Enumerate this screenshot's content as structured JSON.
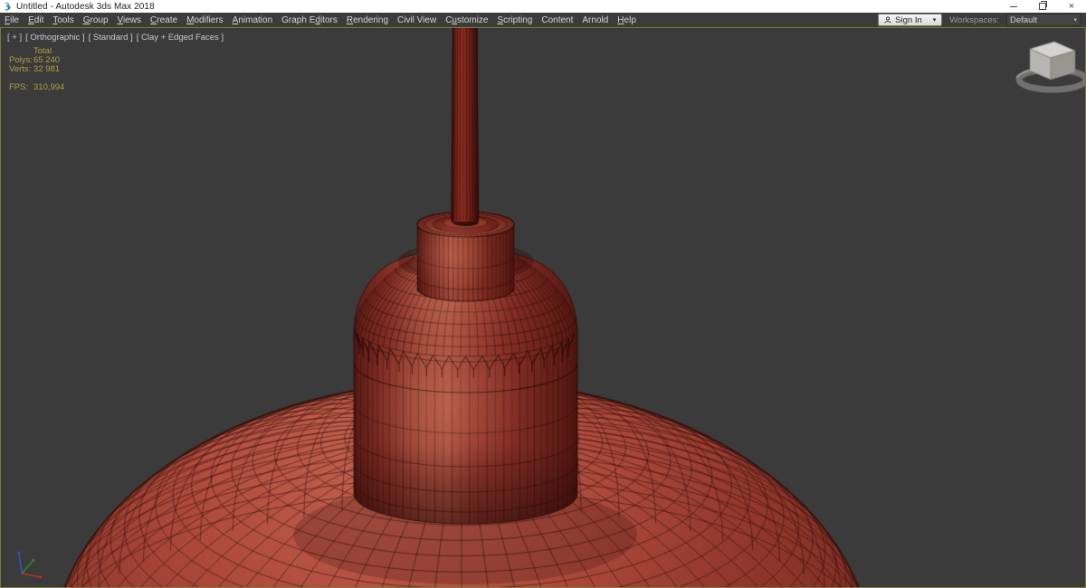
{
  "window": {
    "title": "Untitled - Autodesk 3ds Max 2018",
    "app_icon": "3ds-max-logo-icon",
    "controls": {
      "minimize_icon": "minimize-icon",
      "restore_icon": "restore-window-icon",
      "close_icon": "close-icon",
      "close_glyph": "×"
    }
  },
  "menu_bar": {
    "items": [
      {
        "label": "File",
        "u": 0
      },
      {
        "label": "Edit",
        "u": 0
      },
      {
        "label": "Tools",
        "u": 0
      },
      {
        "label": "Group",
        "u": 0
      },
      {
        "label": "Views",
        "u": 0
      },
      {
        "label": "Create",
        "u": 0
      },
      {
        "label": "Modifiers",
        "u": 0
      },
      {
        "label": "Animation",
        "u": 0
      },
      {
        "label": "Graph Editors",
        "u": 7
      },
      {
        "label": "Rendering",
        "u": 0
      },
      {
        "label": "Civil View",
        "u": -1
      },
      {
        "label": "Customize",
        "u": 1
      },
      {
        "label": "Scripting",
        "u": 0
      },
      {
        "label": "Content",
        "u": -1
      },
      {
        "label": "Arnold",
        "u": -1
      },
      {
        "label": "Help",
        "u": 0
      }
    ],
    "sign_in": {
      "label": "Sign In",
      "icon": "user-icon",
      "caret": "▾"
    },
    "workspaces": {
      "label": "Workspaces:",
      "value": "Default",
      "caret": "▾"
    }
  },
  "viewport": {
    "label_segments": [
      {
        "text": "[ + ]",
        "name": "viewport-general-menu"
      },
      {
        "text": "[ Orthographic ]",
        "name": "viewport-pov-menu"
      },
      {
        "text": "[ Standard ]",
        "name": "viewport-render-preset-menu"
      },
      {
        "text": "[ Clay + Edged Faces ]",
        "name": "viewport-shading-menu"
      }
    ],
    "stats": {
      "total_header": "Total",
      "rows": [
        {
          "label": "Polys:",
          "value": "65 240"
        },
        {
          "label": "Verts:",
          "value": "32 981"
        }
      ],
      "fps_label": "FPS:",
      "fps_value": "310,994"
    },
    "widgets": {
      "viewcube": "viewcube-navigation-widget",
      "axis_tripod": "world-axis-tripod"
    }
  },
  "scene": {
    "description": "Red clay wireframe pendant-lamp model: thin vertical rod, socket cap cylinder, ribbed crown cylinder, wide lat-long dome shade",
    "shading_mode": "Clay + Edged Faces",
    "colors": {
      "viewport_bg": "#3b3b3b",
      "viewport_border": "#7d7936",
      "wire": "rgba(45,13,8,0.55)",
      "wire_soft": "rgba(45,13,8,0.32)",
      "wire_strong": "rgba(28,7,4,0.85)",
      "silhouette": "rgba(48,14,9,0.9)",
      "dome_gradient": [
        "#c05e4d",
        "#ad4a3c",
        "#94392e",
        "#7c2d24"
      ],
      "cyl_gradient": [
        "#5e1d17",
        "#7c2a22",
        "#a04839",
        "#a84f3f",
        "#93382d",
        "#7c2a22",
        "#641f18",
        "#561712"
      ],
      "cap_top_front": "#a04536",
      "cap_top_back": "#7c2a21",
      "cap_recess": "#6d241c",
      "cap_boss": "#8c372b",
      "cap_boss_wall": "#7a2820",
      "cap_hole": "#380d09",
      "rod_gradient": [
        "#4a110d",
        "#7c241b",
        "#8f2f24",
        "#7a241c",
        "#541510",
        "#400d0a"
      ],
      "highlight": "rgba(232,148,116,0.26)",
      "shadow": "rgba(25,5,3,0.5)",
      "contact_shadow": "#2a0805",
      "axis_x": "#c03424",
      "axis_y": "#2f8f2f",
      "axis_z": "#3b4fd0",
      "viewcube_top": "#d4d3d0",
      "viewcube_left": "#b7b6b3",
      "viewcube_right": "#97968f",
      "viewcube_ring": "rgba(158,158,155,0.55)",
      "viewcube_ring_hi": "rgba(230,230,228,0.35)"
    }
  }
}
